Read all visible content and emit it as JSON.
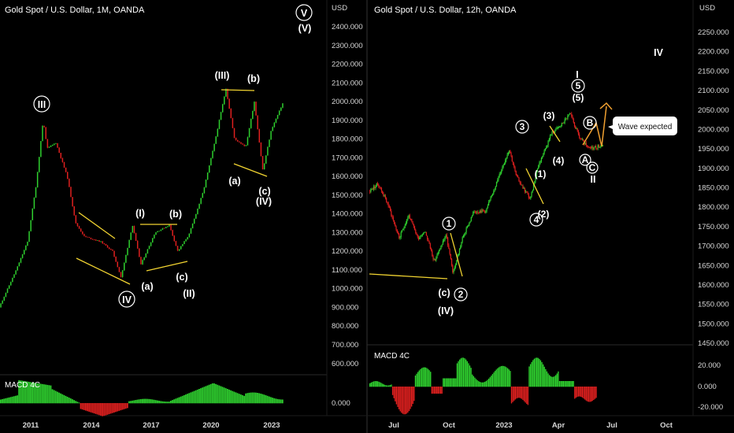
{
  "left": {
    "title": "Gold Spot / U.S. Dollar, 1M, OANDA",
    "currency": "USD",
    "macd_label": "MACD 4C",
    "price_ticks": [
      "2400.000",
      "2300.000",
      "2200.000",
      "2100.000",
      "2000.000",
      "1900.000",
      "1800.000",
      "1700.000",
      "1600.000",
      "1500.000",
      "1400.000",
      "1300.000",
      "1200.000",
      "1100.000",
      "1000.000",
      "900.000",
      "800.000",
      "700.000",
      "600.000"
    ],
    "macd_ticks": [
      "0.000"
    ],
    "time_ticks": [
      "2011",
      "2014",
      "2017",
      "2020",
      "2023"
    ],
    "labels": {
      "III_circ": "III",
      "IV_circ": "IV",
      "V_circ": "V",
      "I_par": "(I)",
      "b1": "(b)",
      "a1": "(a)",
      "c1": "(c)",
      "II_par": "(II)",
      "III_par": "(III)",
      "b2": "(b)",
      "a2": "(a)",
      "c2": "(c)",
      "IV_par": "(IV)",
      "V_par": "(V)"
    }
  },
  "right": {
    "title": "Gold Spot / U.S. Dollar, 12h, OANDA",
    "currency": "USD",
    "macd_label": "MACD 4C",
    "callout": "Wave expected",
    "price_ticks": [
      "2250.000",
      "2200.000",
      "2150.000",
      "2100.000",
      "2050.000",
      "2000.000",
      "1950.000",
      "1900.000",
      "1850.000",
      "1800.000",
      "1750.000",
      "1700.000",
      "1650.000",
      "1600.000",
      "1550.000",
      "1500.000",
      "1450.000"
    ],
    "macd_ticks": [
      "20.000",
      "0.000",
      "-20.000"
    ],
    "time_ticks": [
      "Jul",
      "Oct",
      "2023",
      "Apr",
      "Jul",
      "Oct"
    ],
    "labels": {
      "one": "1",
      "two": "2",
      "three": "3",
      "four": "4",
      "five": "5",
      "A": "A",
      "B": "B",
      "C": "C",
      "c_par": "(c)",
      "IV_par": "(IV)",
      "one_par": "(1)",
      "two_par": "(2)",
      "three_par": "(3)",
      "four_par": "(4)",
      "five_par": "(5)",
      "I": "I",
      "II": "II",
      "IV": "IV"
    }
  },
  "colors": {
    "up": "#2fd12f",
    "down": "#e0201f",
    "pattern": "#f2d431",
    "projection": "#f0a030"
  },
  "chart_data": [
    {
      "type": "line",
      "title": "Gold Spot / U.S. Dollar, 1M, OANDA",
      "ylabel": "USD",
      "ylim": [
        600,
        2400
      ],
      "x": [
        "2009",
        "2010",
        "2011",
        "2011.7",
        "2012",
        "2013",
        "2013.5",
        "2014",
        "2015",
        "2015.9",
        "2016.5",
        "2017",
        "2017.6",
        "2018.7",
        "2019",
        "2020",
        "2020.6",
        "2021",
        "2022",
        "2022.8",
        "2023",
        "2023.3"
      ],
      "series": [
        {
          "values": [
            900,
            1150,
            1500,
            1900,
            1700,
            1600,
            1250,
            1300,
            1200,
            1050,
            1350,
            1200,
            1340,
            1180,
            1400,
            1600,
            2070,
            1800,
            1950,
            1620,
            1900,
            1990
          ]
        }
      ]
    },
    {
      "type": "line",
      "title": "Gold Spot / U.S. Dollar, 12h, OANDA",
      "ylabel": "USD",
      "ylim": [
        1450,
        2250
      ],
      "x": [
        "2022-05",
        "2022-06",
        "2022-07",
        "2022-08",
        "2022-09",
        "2022-10",
        "2022-11",
        "2022-12",
        "2023-01",
        "2023-02",
        "2023-03",
        "2023-04",
        "2023-05",
        "2023-06"
      ],
      "series": [
        {
          "values": [
            1850,
            1840,
            1700,
            1800,
            1670,
            1620,
            1750,
            1800,
            1940,
            1810,
            1990,
            2040,
            1960,
            1950
          ]
        }
      ]
    }
  ]
}
